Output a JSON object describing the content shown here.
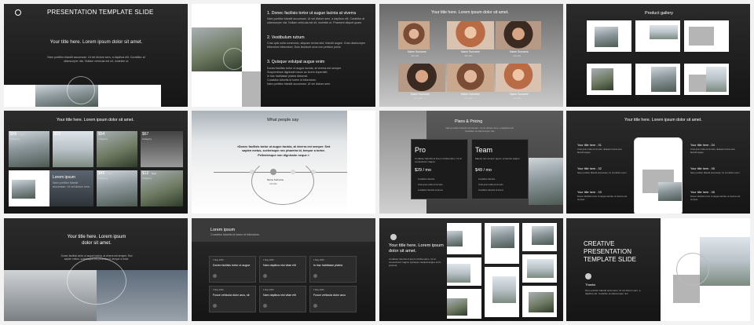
{
  "s1": {
    "title": "PRESENTATION TEMPLATE SLIDE",
    "heading": "Your title here. Lorem ipsum dolor sit amet.",
    "body": "Nam porttitor blandit accumsan. Ut vel dictum sem, a dapibus elit. Curabitur at ullamcorper nisi. Nullam vehicula est sit, molestie ut."
  },
  "s2": {
    "h1": "1. Donec facilisis tortor ut augue lacinia at viverra",
    "b1": "Nam porttitor blandit accumsan. Ut vel dictum sem, a dapibus elit. Curabitur at ullamcorper nisi. Nullam vehicula est sit, molestie ut. Praesent aliquet quam.",
    "h2": "2. Vestibulum rutrum",
    "b2": "Cras quis nulla commodo, aliquam lectus sed, blandit augue. Cras ullamcorper bibendum bibendum. Duis tincidunt urna non pretium porta.",
    "h3": "3. Quisque volutpat augue enim",
    "bullets": [
      "Donec facilisis tortor ut augue lacinia, at viverra est semper.",
      "Suspendisse dignissim lacus ac lorem imperdiet.",
      "In hac habitasse platea dictumst.",
      "Curabitur lobortis id lorem id bibendum.",
      "Nam porttitor blandit accumsan. Ut vel dictum sem."
    ]
  },
  "s3": {
    "title": "Your title here. Lorem ipsum dolor sit amet.",
    "people": [
      {
        "name": "Name Surname",
        "role": "Job title"
      },
      {
        "name": "Name Surname",
        "role": "Job title"
      },
      {
        "name": "Name Surname",
        "role": "Job title"
      },
      {
        "name": "Name Surname",
        "role": "Job title"
      },
      {
        "name": "Name Surname",
        "role": "Job title"
      },
      {
        "name": "Name Surname",
        "role": "Job title"
      }
    ]
  },
  "s4": {
    "title": "Product gallery"
  },
  "s5": {
    "title": "Your title here. Lorem ipsum dolor sit amet.",
    "prices": [
      {
        "price": "$56",
        "old": "$99",
        "cat": "Category"
      },
      {
        "price": "$23",
        "old": "",
        "cat": "Category"
      },
      {
        "price": "$54",
        "old": "",
        "cat": "Category"
      },
      {
        "price": "$67",
        "old": "",
        "cat": "Category"
      },
      {
        "price": "$45",
        "old": "$56",
        "cat": "Category"
      },
      {
        "price": "$12",
        "old": "$33",
        "cat": "Category"
      }
    ],
    "feature_title": "Lorem ipsum",
    "feature_text": "Nam porttitor blandit accumsan. Ut vel dictum sem."
  },
  "s6": {
    "title": "What people say",
    "quote": "«Donec facilisis tortor ut augue lacinia, at viverra est semper. Sed sapien metus, scelerisque nec pharetra id, tempor a tortor. Pellentesque non dignissim neque.»",
    "name": "Name Surname",
    "role": "Job title"
  },
  "s7": {
    "title": "Plans & Pricing",
    "subtitle": "Nam porttitor blandit accumsan. Ut vel dictum sem, a dapibus elit. Curabitur at ullamcorper nisi.",
    "plans": [
      {
        "name": "Pro",
        "desc": "Curabitur lobortis id lorem id bibendum. Ut id consectetur magna.",
        "price": "$29 / mo",
        "features": [
          "Curabitur lobortis",
          "Cras quis nulla commodo",
          "Curabitur lobortis id lorem"
        ]
      },
      {
        "name": "Team",
        "desc": "Mauris non tempor quam, et lacinia sapien.",
        "price": "$49 / mo",
        "features": [
          "Curabitur lobortis",
          "Cras quis nulla commodo",
          "Curabitur lobortis id lorem"
        ]
      }
    ]
  },
  "s8": {
    "title": "Your title here. Lorem ipsum dolor sit amet.",
    "items": [
      {
        "title": "Your title here - 01",
        "text": "Cras quis nulla commodo, aliquam lectus sed, blandit augue."
      },
      {
        "title": "Your title here - 02",
        "text": "Nam porttitor blandit accumsan. Ut vel dictum sem."
      },
      {
        "title": "Your title here - 03",
        "text": "Donec facilisis tortor ut augue lacinia, at viverra est semper."
      },
      {
        "title": "Your title here - 04",
        "text": "Cras quis nulla commodo, aliquam lectus sed, blandit augue."
      },
      {
        "title": "Your title here - 05",
        "text": "Nam porttitor blandit accumsan. Ut vel dictum sem."
      },
      {
        "title": "Your title here - 06",
        "text": "Donec facilisis tortor ut augue lacinia, at viverra est semper."
      }
    ]
  },
  "s9": {
    "heading": "Your title here. Lorem ipsum dolor sit amet.",
    "body": "Donec facilisis tortor ut augue lacinia, at viverra est semper. Sed sapien metus, scelerisque nec pharetra id, tempor a tortor."
  },
  "s10": {
    "title": "Lorem ipsum",
    "subtitle": "Curabitur lobortis id lorem id bibendum.",
    "cards": [
      {
        "date": "1 May 2020",
        "title": "Donec facilisis tortor ut augue"
      },
      {
        "date": "1 May 2020",
        "title": "Nam dapibus nisl vitae elit"
      },
      {
        "date": "1 May 2020",
        "title": "In hac habitasse platea"
      },
      {
        "date": "1 May 2020",
        "title": "Fusce vehicula dolor arcu, sit"
      },
      {
        "date": "1 May 2020",
        "title": "Nam dapibus nisl vitae elit"
      },
      {
        "date": "1 May 2020",
        "title": "Fusce vehicula dolor arcu"
      }
    ]
  },
  "s11": {
    "heading": "Your title here. Lorem ipsum dolor sit amet.",
    "body": "Curabitur lobortis id lorem id bibendum. Ut id consectetur magna. Quisque volutpat augue enim, pulvinar."
  },
  "s12": {
    "title": "CREATIVE PRESENTATION TEMPLATE SLIDE",
    "label": "Thanks",
    "body": "Nam porttitor blandit accumsan. Ut vel dictum sem, a dapibus elit. Curabitur at ullamcorper nisi."
  }
}
